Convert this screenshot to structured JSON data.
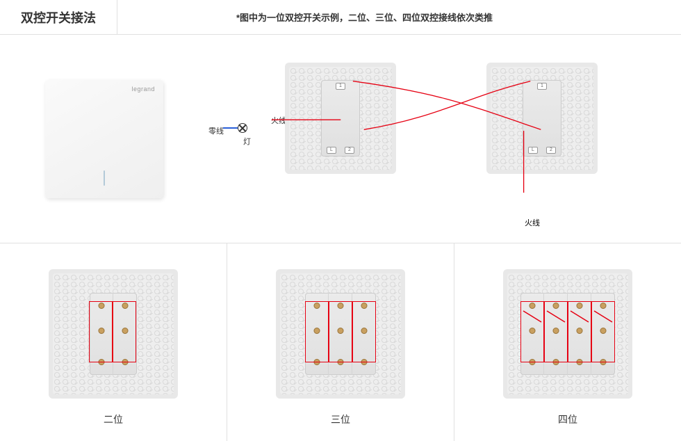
{
  "header": {
    "title": "双控开关接法",
    "subtitle": "*图中为一位双控开关示例，二位、三位、四位双控接线依次类推"
  },
  "brand": "legrand",
  "diagram": {
    "neutral_label": "零线",
    "lamp_label": "灯",
    "live_label_a": "火线",
    "live_label_b": "火线",
    "terminals": {
      "top": "1",
      "bottom_left": "L",
      "bottom_right": "2"
    }
  },
  "variants": {
    "two": "二位",
    "three": "三位",
    "four": "四位"
  }
}
